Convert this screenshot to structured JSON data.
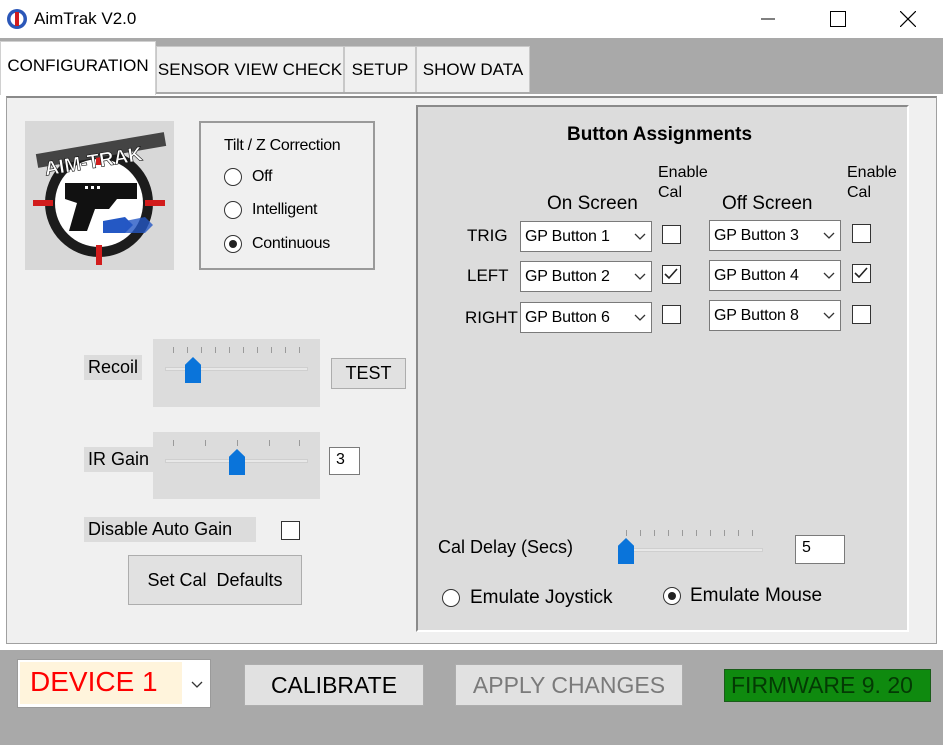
{
  "window": {
    "title": "AimTrak V2.0",
    "app_icon": "aimtrak-app-icon",
    "controls": [
      "minimize-icon",
      "maximize-icon",
      "close-icon"
    ]
  },
  "tabs": [
    {
      "label": "CONFIGURATION",
      "active": true
    },
    {
      "label": "SENSOR VIEW CHECK",
      "active": false
    },
    {
      "label": "SETUP",
      "active": false
    },
    {
      "label": "SHOW DATA",
      "active": false
    }
  ],
  "logo": {
    "text": "AIM-TRAK"
  },
  "tilt": {
    "title": "Tilt / Z Correction",
    "options": [
      {
        "label": "Off",
        "selected": false
      },
      {
        "label": "Intelligent",
        "selected": false
      },
      {
        "label": "Continuous",
        "selected": true
      }
    ]
  },
  "recoil": {
    "label": "Recoil",
    "test_label": "TEST",
    "slider_level_fraction": 0.2
  },
  "ir_gain": {
    "label": "IR Gain",
    "value": "3",
    "slider_level_fraction": 0.5
  },
  "auto_gain": {
    "label": "Disable Auto Gain",
    "checked": false
  },
  "set_cal": {
    "label": "Set Cal  Defaults"
  },
  "assignments": {
    "title": "Button Assignments",
    "on_screen_header": "On Screen",
    "off_screen_header": "Off Screen",
    "enable_cal_header": [
      "Enable",
      "Cal"
    ],
    "rows": [
      {
        "label": "TRIG",
        "on": "GP Button 1",
        "on_cal": false,
        "off": "GP Button 3",
        "off_cal": false
      },
      {
        "label": "LEFT",
        "on": "GP Button 2",
        "on_cal": true,
        "off": "GP Button 4",
        "off_cal": true
      },
      {
        "label": "RIGHT",
        "on": "GP Button 6",
        "on_cal": false,
        "off": "GP Button 8",
        "off_cal": false
      }
    ],
    "cal_delay": {
      "label": "Cal Delay (Secs)",
      "value": "5",
      "slider_level_fraction": 0.0
    },
    "emulate": [
      {
        "label": "Emulate Joystick",
        "selected": false
      },
      {
        "label": "Emulate Mouse",
        "selected": true
      }
    ]
  },
  "bottom": {
    "device": "DEVICE 1",
    "calibrate": "CALIBRATE",
    "apply": "APPLY CHANGES",
    "firmware": "FIRMWARE 9. 20"
  },
  "colors": {
    "accent_blue": "#0a74da",
    "device_text": "#ff0000",
    "firmware_bg": "#0f8a0f"
  }
}
